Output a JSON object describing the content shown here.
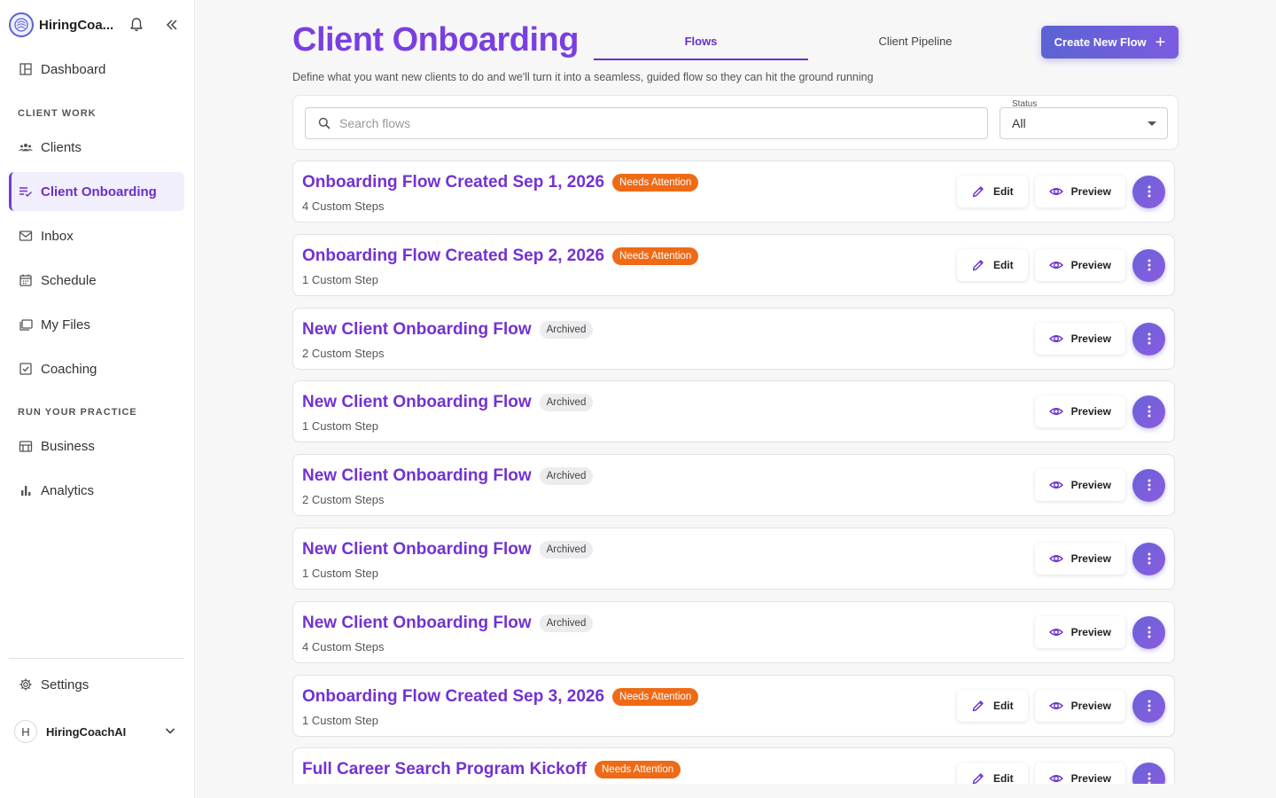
{
  "brand": {
    "name": "HiringCoa..."
  },
  "nav": {
    "dashboard": "Dashboard",
    "section_client_work": "CLIENT WORK",
    "clients": "Clients",
    "client_onboarding": "Client Onboarding",
    "inbox": "Inbox",
    "schedule": "Schedule",
    "my_files": "My Files",
    "coaching": "Coaching",
    "section_practice": "RUN YOUR PRACTICE",
    "business": "Business",
    "analytics": "Analytics",
    "settings": "Settings"
  },
  "user": {
    "initial": "H",
    "name": "HiringCoachAI"
  },
  "header": {
    "title": "Client Onboarding",
    "subtitle": "Define what you want new clients to do and we'll turn it into a seamless, guided flow so they can hit the ground running",
    "create_label": "Create New Flow",
    "create_plus": "+"
  },
  "tabs": [
    {
      "label": "Flows",
      "active": true
    },
    {
      "label": "Client Pipeline",
      "active": false
    }
  ],
  "filters": {
    "search_placeholder": "Search flows",
    "status_label": "Status",
    "status_value": "All"
  },
  "actions": {
    "edit": "Edit",
    "preview": "Preview"
  },
  "flows": [
    {
      "title": "Onboarding Flow Created Sep 1, 2026",
      "badge": "Needs Attention",
      "badge_type": "attention",
      "steps": "4 Custom Steps",
      "editable": true
    },
    {
      "title": "Onboarding Flow Created Sep 2, 2026",
      "badge": "Needs Attention",
      "badge_type": "attention",
      "steps": "1 Custom Step",
      "editable": true
    },
    {
      "title": "New Client Onboarding Flow",
      "badge": "Archived",
      "badge_type": "archived",
      "steps": "2 Custom Steps",
      "editable": false
    },
    {
      "title": "New Client Onboarding Flow",
      "badge": "Archived",
      "badge_type": "archived",
      "steps": "1 Custom Step",
      "editable": false
    },
    {
      "title": "New Client Onboarding Flow",
      "badge": "Archived",
      "badge_type": "archived",
      "steps": "2 Custom Steps",
      "editable": false
    },
    {
      "title": "New Client Onboarding Flow",
      "badge": "Archived",
      "badge_type": "archived",
      "steps": "1 Custom Step",
      "editable": false
    },
    {
      "title": "New Client Onboarding Flow",
      "badge": "Archived",
      "badge_type": "archived",
      "steps": "4 Custom Steps",
      "editable": false
    },
    {
      "title": "Onboarding Flow Created Sep 3, 2026",
      "badge": "Needs Attention",
      "badge_type": "attention",
      "steps": "1 Custom Step",
      "editable": true
    },
    {
      "title": "Full Career Search Program Kickoff",
      "badge": "Needs Attention",
      "badge_type": "attention",
      "steps": "",
      "editable": true
    }
  ],
  "colors": {
    "accent": "#7332d1",
    "attention_badge": "#ef6a16",
    "archived_badge": "#ececee",
    "primary_button": "#5b63d3"
  },
  "icons": {
    "bell": "bell-icon",
    "collapse": "double-chevron-left-icon",
    "dashboard": "dashboard-icon",
    "clients": "people-icon",
    "onboarding": "checklist-icon",
    "inbox": "mail-icon",
    "schedule": "calendar-icon",
    "files": "folders-icon",
    "coaching": "checkbox-icon",
    "business": "business-icon",
    "analytics": "bar-chart-icon",
    "settings": "gear-icon",
    "edit": "pencil-icon",
    "preview": "eye-icon",
    "more": "more-vertical-icon",
    "search": "search-icon"
  }
}
